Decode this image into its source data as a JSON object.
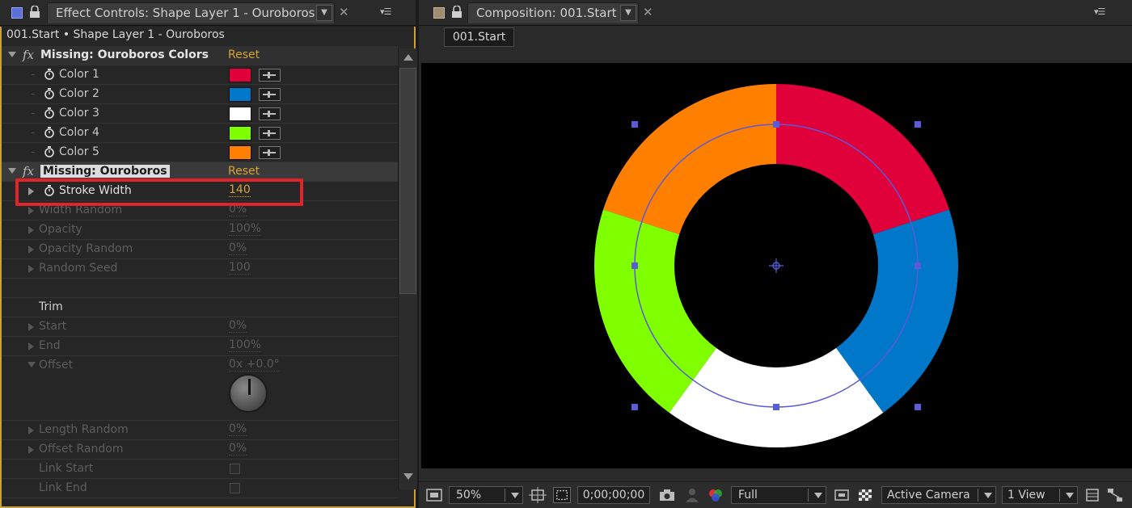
{
  "effect_controls": {
    "tab_title": "Effect Controls: Shape Layer 1 - Ouroboros",
    "breadcrumb": "001.Start • Shape Layer 1 - Ouroboros",
    "groups": [
      {
        "fx_label": "fx",
        "name": "Missing: Ouroboros Colors",
        "reset": "Reset",
        "colors": [
          {
            "label": "Color 1",
            "swatch": "#e0003a"
          },
          {
            "label": "Color 2",
            "swatch": "#0077c8"
          },
          {
            "label": "Color 3",
            "swatch": "#ffffff"
          },
          {
            "label": "Color 4",
            "swatch": "#7fff00"
          },
          {
            "label": "Color 5",
            "swatch": "#ff7f00"
          }
        ]
      },
      {
        "fx_label": "fx",
        "name": "Missing: Ouroboros",
        "reset": "Reset"
      }
    ],
    "stroke_width": {
      "label": "Stroke Width",
      "value": "140"
    },
    "properties": [
      {
        "label": "Width Random",
        "value": "0%"
      },
      {
        "label": "Opacity",
        "value": "100%"
      },
      {
        "label": "Opacity Random",
        "value": "0%"
      },
      {
        "label": "Random Seed",
        "value": "100"
      }
    ],
    "trim_label": "Trim",
    "trim_properties": [
      {
        "label": "Start",
        "value": "0%"
      },
      {
        "label": "End",
        "value": "100%"
      },
      {
        "label": "Offset",
        "value": "0x +0.0°"
      }
    ],
    "more_properties": [
      {
        "label": "Length Random",
        "value": "0%"
      },
      {
        "label": "Offset Random",
        "value": "0%"
      },
      {
        "label": "Link Start"
      },
      {
        "label": "Link End"
      }
    ]
  },
  "composition": {
    "tab_title": "Composition: 001.Start",
    "comp_chip": "001.Start",
    "ring_segments": [
      "#e0003a",
      "#0077c8",
      "#ffffff",
      "#7fff00",
      "#ff7f00"
    ],
    "path_color": "#5b5bd6"
  },
  "toolbar": {
    "zoom": "50%",
    "timecode": "0;00;00;00",
    "resolution": "Full",
    "camera": "Active Camera",
    "views": "1 View"
  },
  "icons": {
    "panel": "panel-icon",
    "lock": "lock-icon",
    "stopwatch": "stopwatch-icon",
    "eyedropper": "eyedropper-icon",
    "snapshot": "camera-snapshot-icon"
  }
}
